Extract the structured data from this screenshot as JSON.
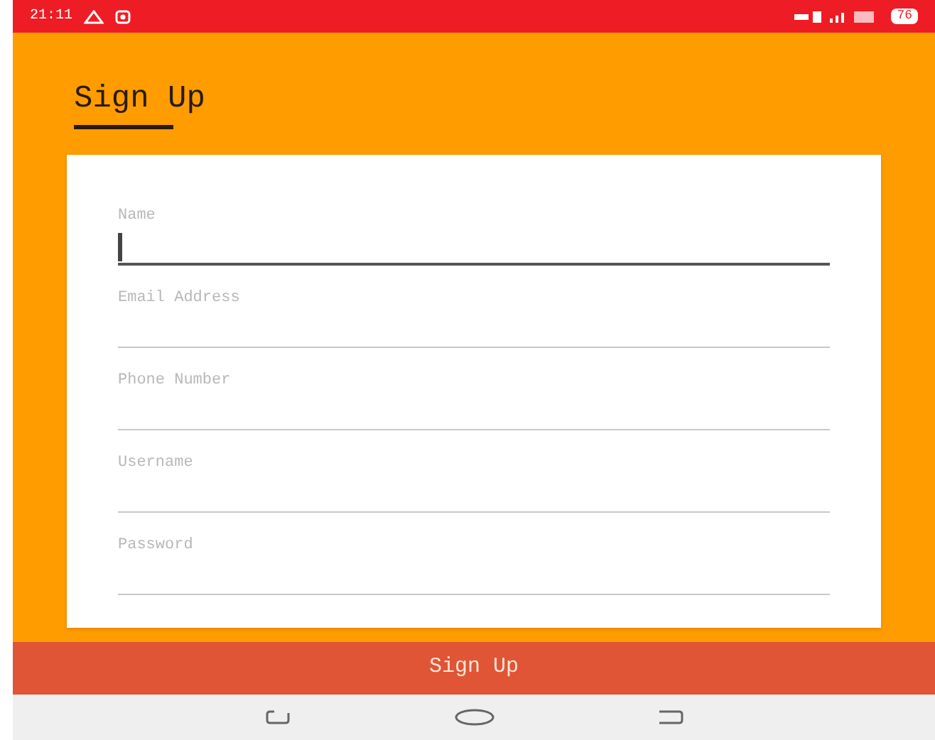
{
  "status_bar": {
    "time": "21:11",
    "battery": "76"
  },
  "title": "Sign Up",
  "fields": [
    {
      "placeholder": "Name",
      "focused": true
    },
    {
      "placeholder": "Email Address",
      "focused": false
    },
    {
      "placeholder": "Phone Number",
      "focused": false
    },
    {
      "placeholder": "Username",
      "focused": false
    },
    {
      "placeholder": "Password",
      "focused": false
    }
  ],
  "submit_button": "Sign Up"
}
